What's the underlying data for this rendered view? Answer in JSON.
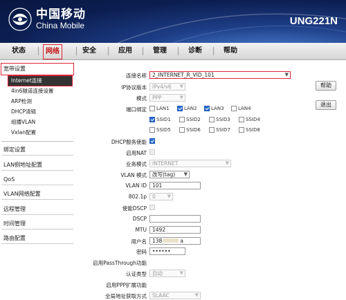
{
  "brand": {
    "cn": "中国移动",
    "en": "China Mobile",
    "model": "UNG221N"
  },
  "nav": [
    "状态",
    "网络",
    "安全",
    "应用",
    "管理",
    "诊断",
    "帮助"
  ],
  "sidebar": {
    "wan_title": "宽带设置",
    "wan_items": [
      "Internet连接",
      "4in6隧道连接设置",
      "ARP检测",
      "DHCP清链",
      "组播VLAN",
      "Vxlan配置"
    ],
    "sections": [
      "绑定设置",
      "LAN侧地址配置",
      "QoS",
      "VLAN网络配置",
      "远程管理",
      "时间管理",
      "路由配置"
    ]
  },
  "buttons": {
    "help": "帮助",
    "exit": "退出"
  },
  "form": {
    "conn_name_label": "连接名称",
    "conn_name_value": "2_INTERNET_R_VID_101",
    "ip_version_label": "IP协议版本",
    "ip_version_value": "IPv4/v6",
    "mode_label": "模式",
    "mode_value": "PPP",
    "port_bind_label": "端口绑定",
    "ports": [
      "LAN1",
      "LAN2",
      "LAN3",
      "LAN4"
    ],
    "ssids_row1": [
      "SSID1",
      "SSID2",
      "SSID3",
      "SSID4"
    ],
    "ssids_row2": [
      "SSID5",
      "SSID6",
      "SSID7",
      "SSID8"
    ],
    "dhcp_label": "DHCP服务使能",
    "nat_label": "启用NAT",
    "service_label": "业务模式",
    "service_value": "INTERNET",
    "vlan_mode_label": "VLAN 模式",
    "vlan_mode_value": "改写(tag)",
    "vlan_id_label": "VLAN ID",
    "vlan_id_value": "101",
    "dot1p_label": "802.1p",
    "dot1p_value": "0",
    "dscp_enable_label": "使能DSCP",
    "dscp_label": "DSCP",
    "mtu_label": "MTU",
    "mtu_value": "1492",
    "user_label": "用户名",
    "user_value": "138",
    "user_suffix": "a",
    "pwd_label": "密码",
    "pwd_value": "••••••",
    "passthrough_label": "启用PassThrough功能",
    "auth_label": "认证类型",
    "auth_value": "自动",
    "ppp_ext_label": "启用PPP扩展功能",
    "dns_label": "全局地址获取方式",
    "dns_value": "SLAAC"
  },
  "colors": {
    "header": "#0c1f52",
    "active_nav": "#c41a1a",
    "highlight_border": "#dd2233",
    "checkbox_on": "#2a6fd6"
  }
}
